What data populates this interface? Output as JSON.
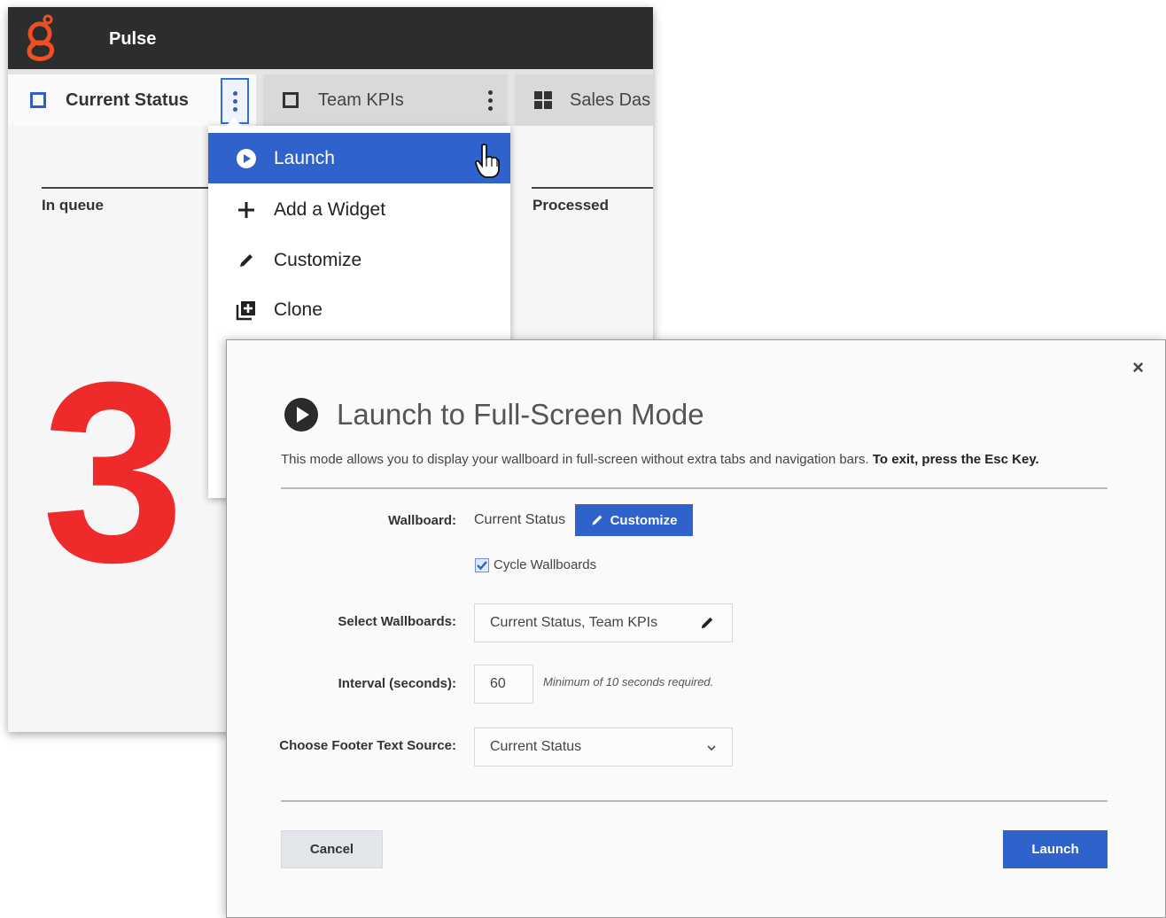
{
  "app": {
    "title": "Pulse",
    "brand_color": "#f04e23",
    "tabs": [
      {
        "label": "Current Status",
        "icon": "square-outline-icon",
        "active": true
      },
      {
        "label": "Team KPIs",
        "icon": "square-outline-icon",
        "active": false
      },
      {
        "label": "Sales Das",
        "icon": "grid-icon",
        "active": false
      }
    ],
    "widgets": [
      {
        "label": "In queue",
        "value": "3"
      },
      {
        "label": "Processed"
      }
    ]
  },
  "menu": {
    "items": [
      {
        "label": "Launch",
        "icon": "play-circle-icon",
        "highlighted": true
      },
      {
        "label": "Add a Widget",
        "icon": "plus-icon"
      },
      {
        "label": "Customize",
        "icon": "pencil-icon"
      },
      {
        "label": "Clone",
        "icon": "clone-icon"
      }
    ]
  },
  "dialog": {
    "close_label": "×",
    "title": "Launch to Full-Screen Mode",
    "description": "This mode allows you to display your wallboard in full-screen without extra tabs and navigation bars.",
    "description_bold": "To exit, press the Esc Key.",
    "wallboard_label": "Wallboard:",
    "wallboard_value": "Current Status",
    "customize_label": "Customize",
    "cycle_label": "Cycle Wallboards",
    "cycle_checked": true,
    "select_label": "Select Wallboards:",
    "select_value": "Current Status, Team KPIs",
    "interval_label": "Interval (seconds):",
    "interval_value": "60",
    "interval_hint": "Minimum of 10 seconds required.",
    "footer_label": "Choose Footer Text Source:",
    "footer_value": "Current Status",
    "cancel_label": "Cancel",
    "launch_label": "Launch",
    "accent_color": "#2f62cb"
  }
}
